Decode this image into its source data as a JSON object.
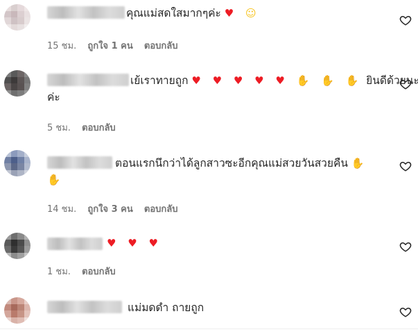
{
  "comments": [
    {
      "text": "คุณแม่สดใสมากๆค่ะ",
      "emoji": "♥ ☺",
      "time": "15 ชม.",
      "likes": "ถูกใจ 1 คน",
      "reply": "ตอบกลับ"
    },
    {
      "text": "เย้เราทายถูก",
      "emoji": "♥ ♥ ♥ ♥ ♥ ✋ ✋ ✋",
      "text_after": "ยินดีด้วยนะ",
      "text_line2": "ค่ะ",
      "time": "5 ชม.",
      "reply": "ตอบกลับ"
    },
    {
      "text": "ตอนแรกนึกว่าได้ลูกสาวซะอีกคุณแม่สวยวันสวยคืน",
      "emoji": "✋",
      "emoji_line2": "✋",
      "time": "14 ชม.",
      "likes": "ถูกใจ 3 คน",
      "reply": "ตอบกลับ"
    },
    {
      "emoji": "♥ ♥ ♥",
      "time": "1 ชม.",
      "reply": "ตอบกลับ"
    },
    {
      "text": "แม่มดดำ ถายถูก"
    }
  ],
  "icons": {
    "like": "heart-outline-icon"
  },
  "colors": {
    "text": "#262626",
    "meta": "#737373",
    "heart": "#ed1c24",
    "clap": "#f7c21a"
  }
}
